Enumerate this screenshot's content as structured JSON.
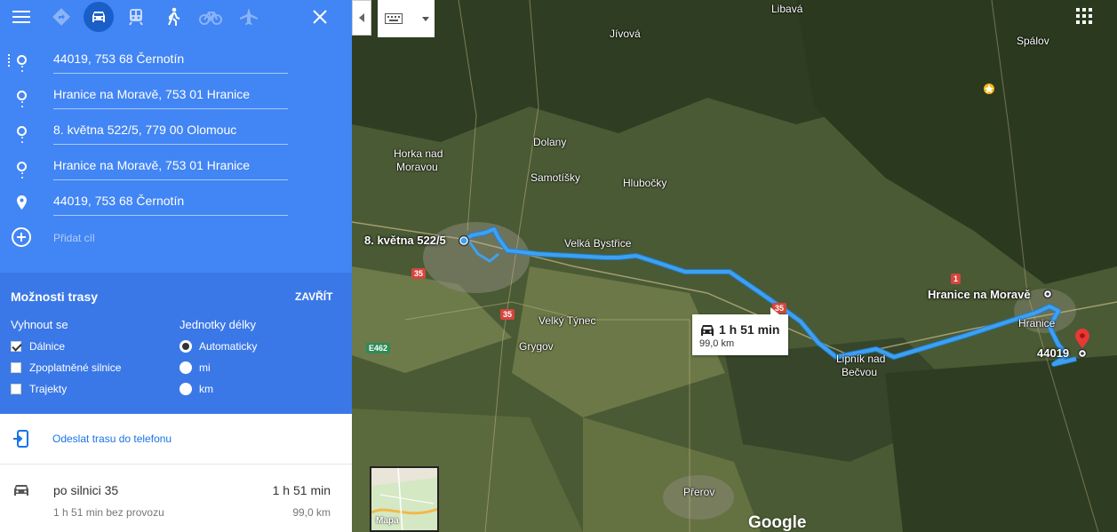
{
  "modes": {
    "menu_icon": "hamburger-menu-icon",
    "items": [
      {
        "name": "best-route",
        "icon": "diamond-directions-icon",
        "active": false
      },
      {
        "name": "car",
        "icon": "car-icon",
        "active": true
      },
      {
        "name": "transit",
        "icon": "train-icon",
        "active": false
      },
      {
        "name": "walk",
        "icon": "walking-icon",
        "active": false
      },
      {
        "name": "bike",
        "icon": "bicycle-icon",
        "active": false
      },
      {
        "name": "flight",
        "icon": "airplane-icon",
        "active": false
      }
    ],
    "close_icon": "close-icon"
  },
  "stops": [
    "44019, 753 68 Černotín",
    "Hranice na Moravě, 753 01 Hranice",
    "8. května 522/5, 779 00 Olomouc",
    "Hranice na Moravě, 753 01 Hranice",
    "44019, 753 68 Černotín"
  ],
  "add_destination": "Přidat cíl",
  "options": {
    "title": "Možnosti trasy",
    "close": "ZAVŘÍT",
    "avoid_heading": "Vyhnout se",
    "avoid": [
      {
        "label": "Dálnice",
        "checked": true
      },
      {
        "label": "Zpoplatněné silnice",
        "checked": false
      },
      {
        "label": "Trajekty",
        "checked": false
      }
    ],
    "units_heading": "Jednotky délky",
    "units": [
      {
        "label": "Automaticky",
        "selected": true
      },
      {
        "label": "mi",
        "selected": false
      },
      {
        "label": "km",
        "selected": false
      }
    ]
  },
  "send_to_phone": "Odeslat trasu do telefonu",
  "route": {
    "via": "po silnici 35",
    "time": "1 h 51 min",
    "subtitle": "1 h 51 min bez provozu",
    "distance": "99,0 km"
  },
  "map": {
    "places": [
      "Libavá",
      "Jívová",
      "Spálov",
      "Dolany",
      "Horka nad",
      "Moravou",
      "Samotíšky",
      "Hlubočky",
      "Velká Bystřice",
      "Velký Týnec",
      "Grygov",
      "Lipník nad",
      "Bečvou",
      "Hranice",
      "Přerov"
    ],
    "bold_places": [
      "8. května 522/5",
      "Hranice na Moravě",
      "44019"
    ],
    "shields": [
      "35",
      "35",
      "35",
      "1",
      "E462"
    ],
    "trip_box": {
      "time": "1 h 51 min",
      "distance": "99,0 km"
    },
    "minimap_label": "Mapa",
    "logo": "Google",
    "route_color": "#3fa0f0",
    "pin_color": "#e53935"
  }
}
